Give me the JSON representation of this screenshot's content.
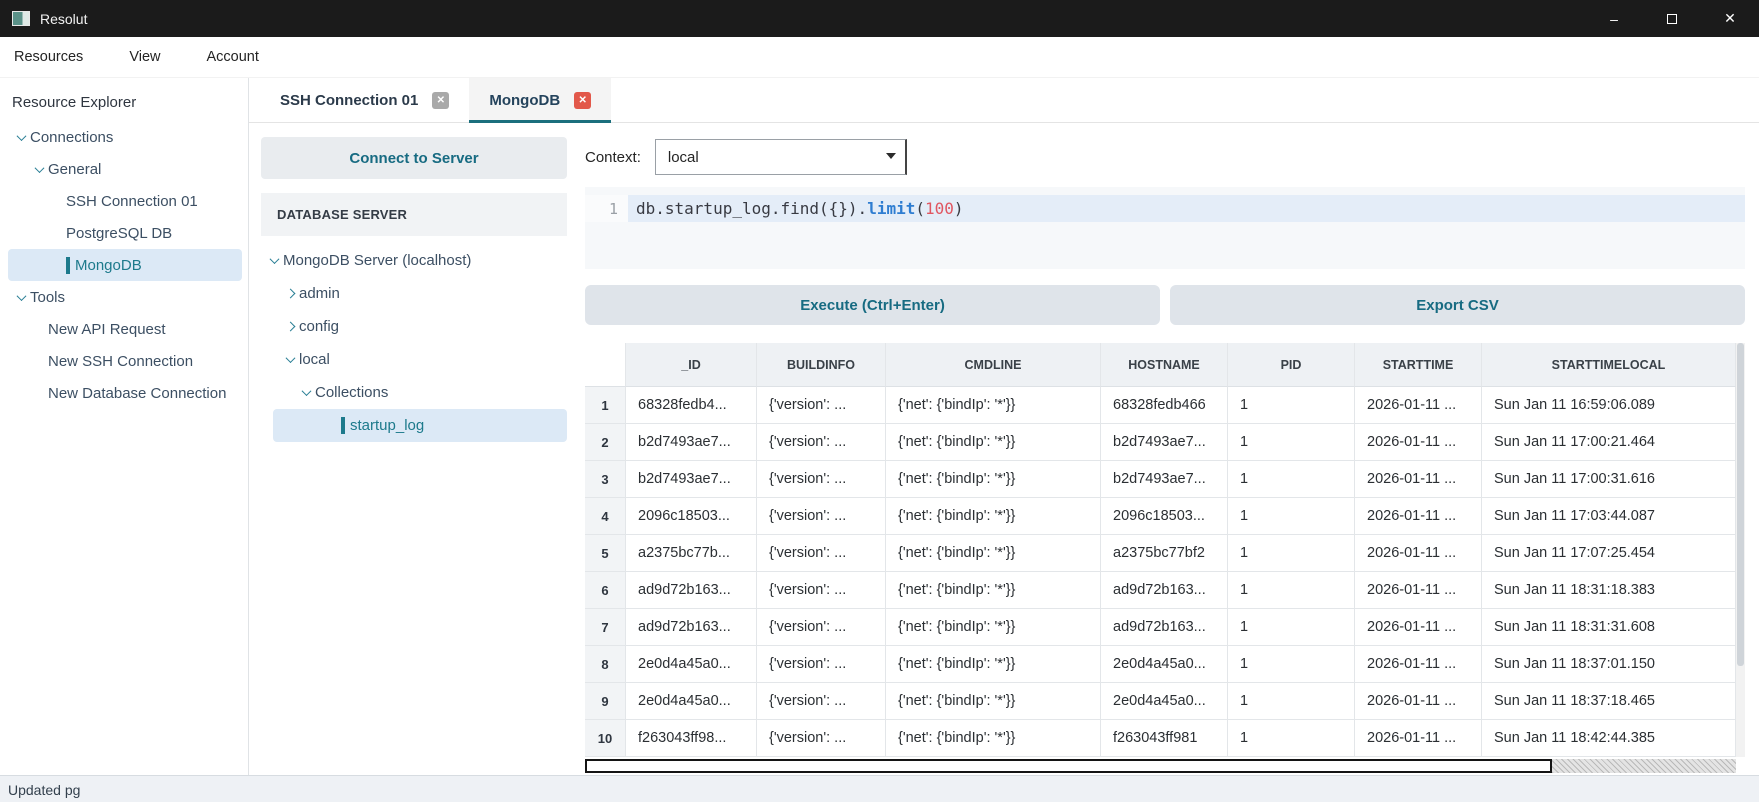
{
  "window": {
    "title": "Resolut",
    "controls": {
      "minimize": "–",
      "close": "✕"
    }
  },
  "menu": {
    "items": [
      "Resources",
      "View",
      "Account"
    ]
  },
  "sidebar": {
    "heading": "Resource Explorer",
    "tree": [
      {
        "label": "Connections",
        "level": 0,
        "chevron": "down"
      },
      {
        "label": "General",
        "level": 1,
        "chevron": "down"
      },
      {
        "label": "SSH Connection 01",
        "level": 2
      },
      {
        "label": "PostgreSQL DB",
        "level": 2
      },
      {
        "label": "MongoDB",
        "level": 2,
        "selected": true
      },
      {
        "label": "Tools",
        "level": 0,
        "chevron": "down"
      },
      {
        "label": "New API Request",
        "level": 1
      },
      {
        "label": "New SSH Connection",
        "level": 1
      },
      {
        "label": "New Database Connection",
        "level": 1
      }
    ]
  },
  "tabs": [
    {
      "label": "SSH Connection 01",
      "active": false
    },
    {
      "label": "MongoDB",
      "active": true
    }
  ],
  "db_panel": {
    "connect_button": "Connect to Server",
    "section_header": "DATABASE SERVER",
    "tree": [
      {
        "label": "MongoDB Server (localhost)",
        "level": 0,
        "chevron": "down"
      },
      {
        "label": "admin",
        "level": 1,
        "chevron": "right"
      },
      {
        "label": "config",
        "level": 1,
        "chevron": "right"
      },
      {
        "label": "local",
        "level": 1,
        "chevron": "down"
      },
      {
        "label": "Collections",
        "level": 2,
        "chevron": "down"
      },
      {
        "label": "startup_log",
        "level": 3,
        "selected": true
      }
    ]
  },
  "query": {
    "context_label": "Context:",
    "context_value": "local",
    "line_number": "1",
    "code_segments": [
      {
        "text": "db.startup_log.find({}).",
        "type": "default"
      },
      {
        "text": "limit",
        "type": "keyword"
      },
      {
        "text": "(",
        "type": "default"
      },
      {
        "text": "100",
        "type": "number"
      },
      {
        "text": ")",
        "type": "default"
      }
    ],
    "execute_button": "Execute (Ctrl+Enter)",
    "export_button": "Export CSV"
  },
  "results": {
    "columns": [
      "_ID",
      "BUILDINFO",
      "CMDLINE",
      "HOSTNAME",
      "PID",
      "STARTTIME",
      "STARTTIMELOCAL"
    ],
    "rows": [
      {
        "n": "1",
        "cells": [
          "68328fedb4...",
          "{'version': ...",
          "{'net': {'bindIp': '*'}}",
          "68328fedb466",
          "1",
          "2026-01-11 ...",
          "Sun Jan 11 16:59:06.089"
        ]
      },
      {
        "n": "2",
        "cells": [
          "b2d7493ae7...",
          "{'version': ...",
          "{'net': {'bindIp': '*'}}",
          "b2d7493ae7...",
          "1",
          "2026-01-11 ...",
          "Sun Jan 11 17:00:21.464"
        ]
      },
      {
        "n": "3",
        "cells": [
          "b2d7493ae7...",
          "{'version': ...",
          "{'net': {'bindIp': '*'}}",
          "b2d7493ae7...",
          "1",
          "2026-01-11 ...",
          "Sun Jan 11 17:00:31.616"
        ]
      },
      {
        "n": "4",
        "cells": [
          "2096c18503...",
          "{'version': ...",
          "{'net': {'bindIp': '*'}}",
          "2096c18503...",
          "1",
          "2026-01-11 ...",
          "Sun Jan 11 17:03:44.087"
        ]
      },
      {
        "n": "5",
        "cells": [
          "a2375bc77b...",
          "{'version': ...",
          "{'net': {'bindIp': '*'}}",
          "a2375bc77bf2",
          "1",
          "2026-01-11 ...",
          "Sun Jan 11 17:07:25.454"
        ]
      },
      {
        "n": "6",
        "cells": [
          "ad9d72b163...",
          "{'version': ...",
          "{'net': {'bindIp': '*'}}",
          "ad9d72b163...",
          "1",
          "2026-01-11 ...",
          "Sun Jan 11 18:31:18.383"
        ]
      },
      {
        "n": "7",
        "cells": [
          "ad9d72b163...",
          "{'version': ...",
          "{'net': {'bindIp': '*'}}",
          "ad9d72b163...",
          "1",
          "2026-01-11 ...",
          "Sun Jan 11 18:31:31.608"
        ]
      },
      {
        "n": "8",
        "cells": [
          "2e0d4a45a0...",
          "{'version': ...",
          "{'net': {'bindIp': '*'}}",
          "2e0d4a45a0...",
          "1",
          "2026-01-11 ...",
          "Sun Jan 11 18:37:01.150"
        ]
      },
      {
        "n": "9",
        "cells": [
          "2e0d4a45a0...",
          "{'version': ...",
          "{'net': {'bindIp': '*'}}",
          "2e0d4a45a0...",
          "1",
          "2026-01-11 ...",
          "Sun Jan 11 18:37:18.465"
        ]
      },
      {
        "n": "10",
        "cells": [
          "f263043ff98...",
          "{'version': ...",
          "{'net': {'bindIp': '*'}}",
          "f263043ff981",
          "1",
          "2026-01-11 ...",
          "Sun Jan 11 18:42:44.385"
        ]
      }
    ]
  },
  "statusbar": {
    "text": "Updated pg"
  },
  "colors": {
    "accent_teal": "#1b6f7d",
    "selection_bg": "#dce9f6",
    "close_red": "#e2584a",
    "keyword_blue": "#2e7dd1",
    "number_red": "#e05661",
    "titlebar": "#1b1b1b"
  }
}
